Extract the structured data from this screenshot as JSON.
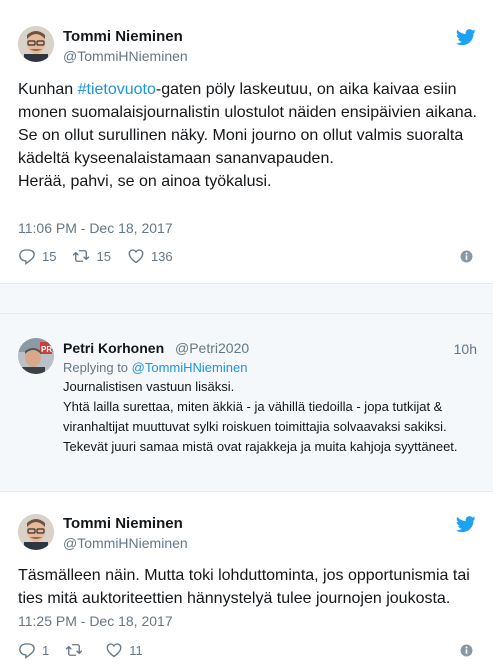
{
  "tweet1": {
    "name": "Tommi Nieminen",
    "handle": "@TommiHNieminen",
    "text_before": "Kunhan ",
    "hashtag": "#tietovuoto",
    "text_after": "-gaten pöly laskeutuu, on aika kaivaa esiin monen suomalaisjournalistin ulostulot näiden ensipäivien aikana.\nSe on ollut surullinen näky. Moni journo on ollut valmis suoralta kädeltä kyseenalaistamaan sananvapauden.\nHerää, pahvi, se on ainoa työkalusi.",
    "timestamp": "11:06 PM - Dec 18, 2017",
    "replies": "15",
    "retweets": "15",
    "likes": "136"
  },
  "reply": {
    "name": "Petri Korhonen",
    "handle": "@Petri2020",
    "time": "10h",
    "replying_prefix": "Replying to ",
    "replying_to": "@TommiHNieminen",
    "text": "Journalistisen vastuun lisäksi.\nYhtä lailla surettaa, miten äkkiä - ja vähillä tiedoilla - jopa tutkijat & viranhaltijat muuttuvat sylki roiskuen toimittajia solvaavaksi sakiksi. Tekevät juuri samaa mistä ovat rajakkeja ja muita kahjoja syyttäneet."
  },
  "tweet2": {
    "name": "Tommi Nieminen",
    "handle": "@TommiHNieminen",
    "text": "Täsmälleen näin. Mutta toki lohduttominta, jos opportunismia tai ties mitä auktoriteettien hännystelyä tulee journojen joukosta.",
    "timestamp": "11:25 PM - Dec 18, 2017",
    "replies": "1",
    "retweets": "",
    "likes": "11"
  },
  "colors": {
    "twitter_blue": "#1da1f2",
    "link": "#1b95e0",
    "secondary_text": "#657786",
    "divider": "#e6ecf0",
    "gap_background": "#f5f8fa"
  },
  "icons": [
    "avatar-tommi",
    "avatar-petri",
    "twitter-bird-icon",
    "reply-icon",
    "retweet-icon",
    "heart-icon",
    "info-icon"
  ]
}
